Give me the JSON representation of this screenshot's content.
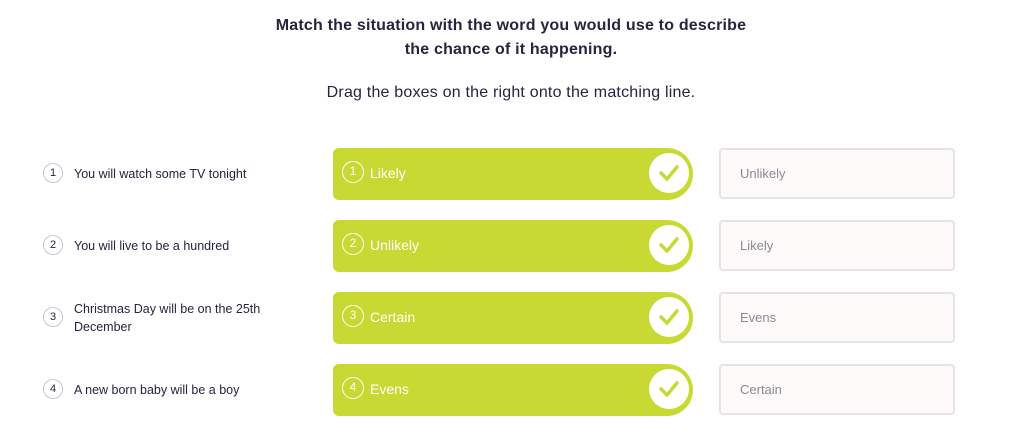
{
  "instructions": {
    "title_line1": "Match the situation with the word you would use to describe",
    "title_line2": "the chance of it happening.",
    "subtitle": "Drag the boxes on the right onto the matching line."
  },
  "rows": [
    {
      "number": "1",
      "situation": "You will watch some TV tonight",
      "answer_number": "1",
      "answer": "Likely",
      "option": "Unlikely"
    },
    {
      "number": "2",
      "situation": "You will live to be a hundred",
      "answer_number": "2",
      "answer": "Unlikely",
      "option": "Likely"
    },
    {
      "number": "3",
      "situation": "Christmas Day will be on the 25th December",
      "answer_number": "3",
      "answer": "Certain",
      "option": "Evens"
    },
    {
      "number": "4",
      "situation": "A new born baby will be a boy",
      "answer_number": "4",
      "answer": "Evens",
      "option": "Certain"
    }
  ],
  "colors": {
    "answer_bg": "#c7d932",
    "check_color": "#c7d932",
    "text": "#2b2240",
    "option_text": "#8d8796"
  },
  "icons": {
    "check": "check-icon"
  }
}
